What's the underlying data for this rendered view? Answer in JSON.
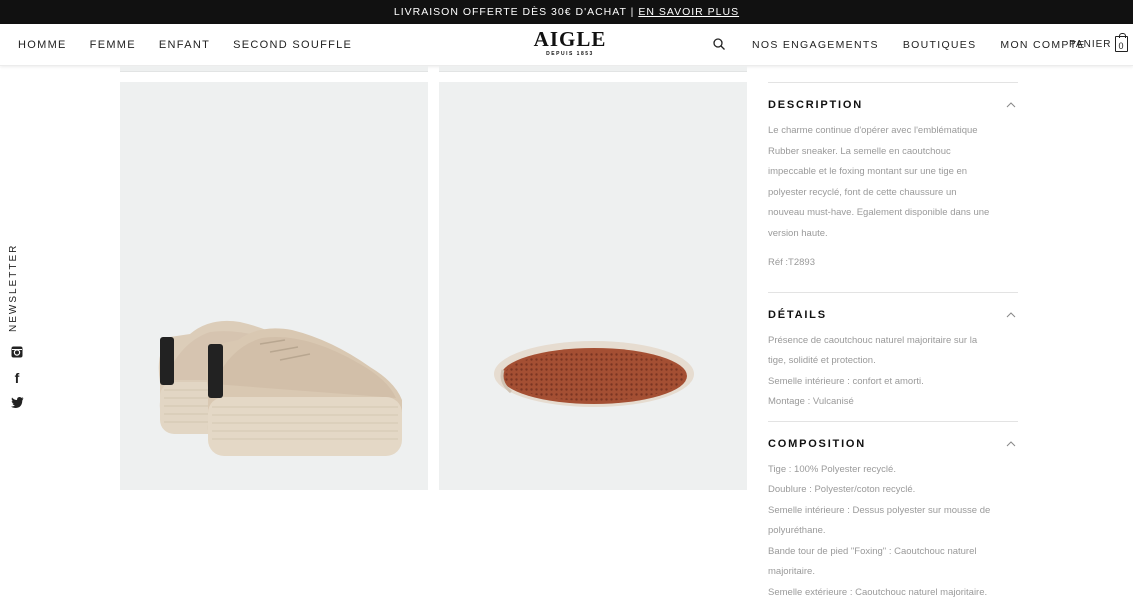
{
  "promo": {
    "text": "LIVRAISON OFFERTE DÈS 30€ D'ACHAT |",
    "link": "EN SAVOIR PLUS"
  },
  "header": {
    "nav_left": [
      "HOMME",
      "FEMME",
      "ENFANT",
      "SECOND SOUFFLE"
    ],
    "logo": {
      "brand": "AIGLE",
      "tagline": "DEPUIS 1853"
    },
    "nav_right": [
      "NOS ENGAGEMENTS",
      "BOUTIQUES",
      "MON COMPTE"
    ],
    "cart": {
      "label": "PANIER",
      "count": "0"
    }
  },
  "side": {
    "newsletter": "NEWSLETTER",
    "social_icons": [
      "instagram-icon",
      "facebook-icon",
      "twitter-icon"
    ]
  },
  "product": {
    "image_bg": "#eef0f0",
    "shoe_color": "#d9c9b6",
    "sole_color": "#9b4a30"
  },
  "sections": {
    "description": {
      "title": "DESCRIPTION",
      "lines": [
        "Le charme continue d'opérer avec l'emblématique",
        "Rubber sneaker. La semelle en caoutchouc",
        "impeccable et le foxing montant sur une tige en",
        "polyester recyclé, font de cette chaussure un",
        "nouveau must-have. Egalement disponible dans une",
        "version haute."
      ],
      "ref": "Réf :T2893"
    },
    "details": {
      "title": "DÉTAILS",
      "lines": [
        "Présence de caoutchouc naturel majoritaire sur la",
        "tige, solidité et protection.",
        "Semelle intérieure : confort et amorti.",
        "Montage : Vulcanisé"
      ]
    },
    "composition": {
      "title": "COMPOSITION",
      "lines": [
        "Tige : 100% Polyester recyclé.",
        "Doublure : Polyester/coton recyclé.",
        "Semelle intérieure : Dessus polyester sur mousse de",
        "polyuréthane.",
        "Bande tour de pied \"Foxing\" : Caoutchouc naturel",
        "majoritaire.",
        "Semelle extérieure : Caoutchouc naturel majoritaire."
      ]
    }
  }
}
